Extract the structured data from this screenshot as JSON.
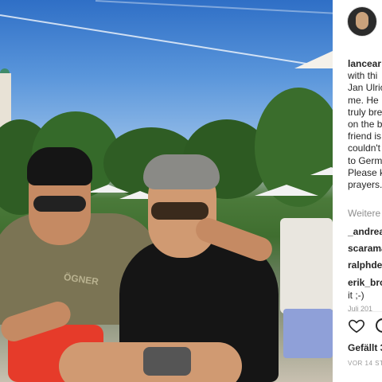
{
  "post": {
    "username": "lancear",
    "caption_lines": [
      "with thi",
      "Jan Ulric",
      "me. He",
      "truly bre",
      "on the b",
      "friend is",
      "couldn't",
      "to Germ",
      "Please k",
      "prayers."
    ],
    "more_comments_label": "Weitere",
    "comments": [
      {
        "user": "_andrea"
      },
      {
        "user": "scarama"
      },
      {
        "user": "ralphde"
      },
      {
        "user": "erik_bro"
      }
    ],
    "last_comment_continuation": "it ;-)",
    "comment_date": "Juli 201",
    "likes_label": "Gefällt 3",
    "timestamp": "VOR 14 ST"
  },
  "photo": {
    "shirt_text": "ÖGNER"
  },
  "icons": {
    "like": "heart-icon",
    "comment": "comment-icon"
  }
}
